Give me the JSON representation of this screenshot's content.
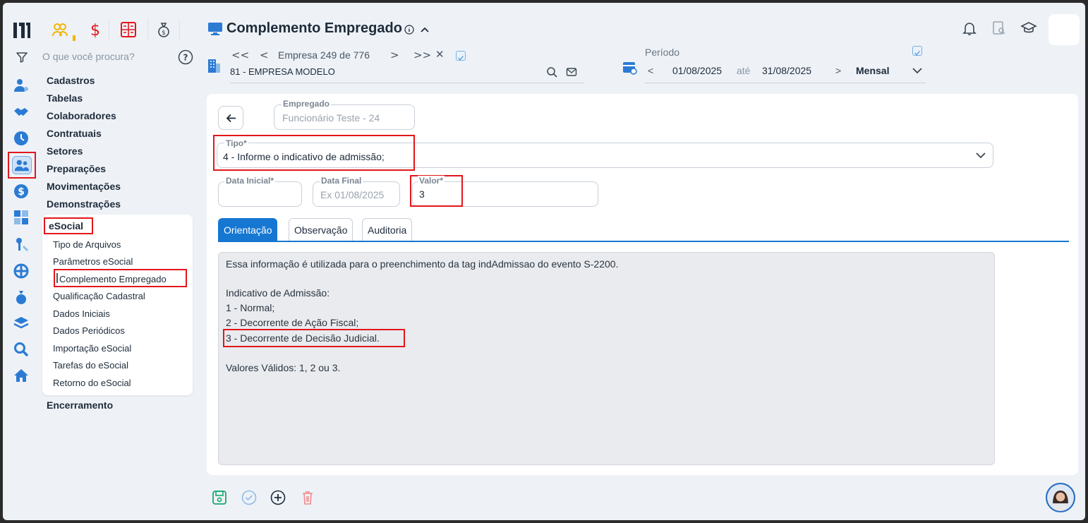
{
  "quick_icons": [
    "people-icon",
    "dollar-icon",
    "calculator-icon",
    "money-bag-icon"
  ],
  "search": {
    "placeholder": "O que você procura?"
  },
  "menu": {
    "items": [
      "Cadastros",
      "Tabelas",
      "Colaboradores",
      "Contratuais",
      "Setores",
      "Preparações",
      "Movimentações",
      "Demonstrações"
    ],
    "esocial": {
      "title": "eSocial",
      "items": [
        "Tipo de Arquivos",
        "Parâmetros eSocial",
        "Complemento Empregado",
        "Qualificação Cadastral",
        "Dados Iniciais",
        "Dados Periódicos",
        "Importação eSocial",
        "Tarefas do eSocial",
        "Retorno do eSocial"
      ],
      "active": "Complemento Empregado"
    },
    "last_item": "Encerramento"
  },
  "header": {
    "title": "Complemento Empregado",
    "empresa": {
      "label": "Empresa",
      "current": "249",
      "of_label": "de",
      "total": "776",
      "name": "81 - EMPRESA MODELO"
    },
    "periodo": {
      "label": "Período",
      "start": "01/08/2025",
      "sep": "até",
      "end": "31/08/2025",
      "mode": "Mensal"
    }
  },
  "form": {
    "empregado": {
      "label": "Empregado",
      "value": "Funcionário Teste - 24"
    },
    "tipo": {
      "label": "Tipo*",
      "value": "4 - Informe o indicativo de admissão;"
    },
    "data_inicial": {
      "label": "Data Inicial*",
      "value": ""
    },
    "data_final": {
      "label": "Data Final",
      "placeholder": "Ex 01/08/2025"
    },
    "valor": {
      "label": "Valor*",
      "value": "3"
    }
  },
  "tabs": [
    "Orientação",
    "Observação",
    "Auditoria"
  ],
  "active_tab": "Orientação",
  "orientacao": [
    "Essa informação é utilizada para o preenchimento da tag indAdmissao do evento S-2200.",
    "Indicativo de Admissão:",
    "1 - Normal;",
    "2 - Decorrente de Ação Fiscal;",
    "3 - Decorrente de Decisão Judicial.",
    "Valores Válidos: 1, 2 ou 3."
  ],
  "colors": {
    "accent": "#1677d2",
    "highlight": "#e3161b",
    "save": "#19a86b",
    "delete": "#f08a8a"
  }
}
